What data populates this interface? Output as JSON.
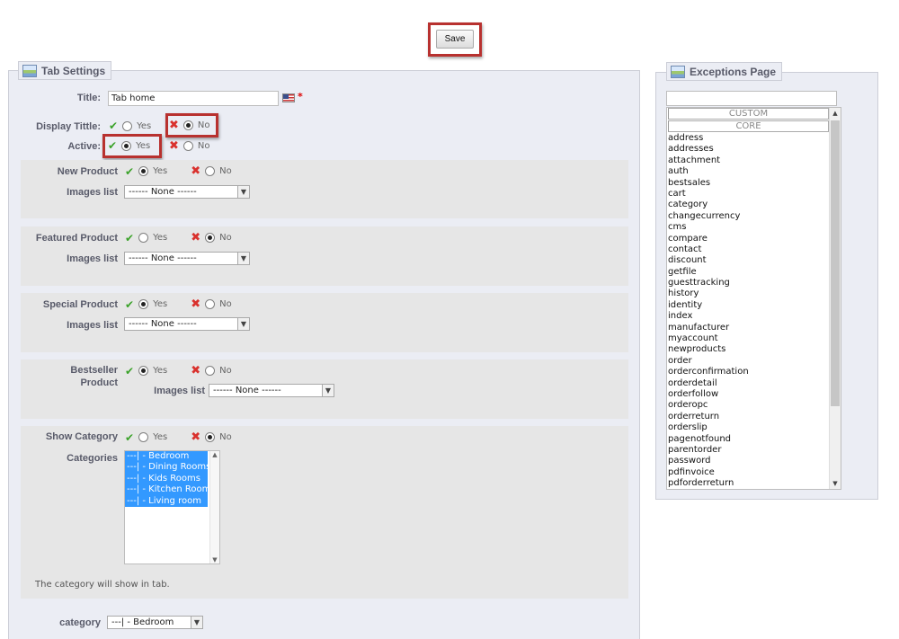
{
  "toolbar": {
    "save_label": "Save"
  },
  "tab_settings": {
    "legend": "Tab Settings",
    "title_label": "Title:",
    "title_value": "Tab home",
    "required_mark": "*",
    "display_title_label": "Display Tittle:",
    "active_label": "Active:",
    "yes": "Yes",
    "no": "No",
    "display_title_selected": "No",
    "active_selected": "Yes"
  },
  "sections": {
    "new_product": {
      "label": "New Product",
      "selected": "Yes",
      "images_label": "Images list",
      "images_value": "------ None ------"
    },
    "featured_product": {
      "label": "Featured Product",
      "selected": "No",
      "images_label": "Images list",
      "images_value": "------ None ------"
    },
    "special_product": {
      "label": "Special Product",
      "selected": "Yes",
      "images_label": "Images list",
      "images_value": "------ None ------"
    },
    "bestseller_product": {
      "label_line1": "Bestseller",
      "label_line2": "Product",
      "selected": "Yes",
      "images_label": "Images list",
      "images_value": "------ None ------"
    },
    "show_category": {
      "label": "Show Category",
      "selected": "No",
      "categories_label": "Categories",
      "categories": [
        "---| - Bedroom",
        "---| - Dining Rooms",
        "---| - Kids Rooms",
        "---| - Kitchen Rooms",
        "---| - Living room"
      ],
      "note": "The category will show in tab."
    }
  },
  "category_field": {
    "label": "category",
    "value": "---| - Bedroom"
  },
  "exceptions": {
    "legend": "Exceptions Page",
    "filter_value": "",
    "headers": [
      "CUSTOM",
      "CORE"
    ],
    "pages": [
      "address",
      "addresses",
      "attachment",
      "auth",
      "bestsales",
      "cart",
      "category",
      "changecurrency",
      "cms",
      "compare",
      "contact",
      "discount",
      "getfile",
      "guesttracking",
      "history",
      "identity",
      "index",
      "manufacturer",
      "myaccount",
      "newproducts",
      "order",
      "orderconfirmation",
      "orderdetail",
      "orderfollow",
      "orderopc",
      "orderreturn",
      "orderslip",
      "pagenotfound",
      "parentorder",
      "password",
      "pdfinvoice",
      "pdforderreturn"
    ]
  },
  "icons": {
    "yes_icon": "check-icon",
    "no_icon": "cross-icon",
    "legend_icon": "picture-icon",
    "language_flag": "us-flag-icon"
  },
  "colors": {
    "highlight": "#b8312f",
    "panel_bg": "#ebedf4",
    "section_bg": "#e6e6e6",
    "selection_bg": "#3399ff",
    "check": "#3aa229",
    "cross": "#d9312d"
  }
}
